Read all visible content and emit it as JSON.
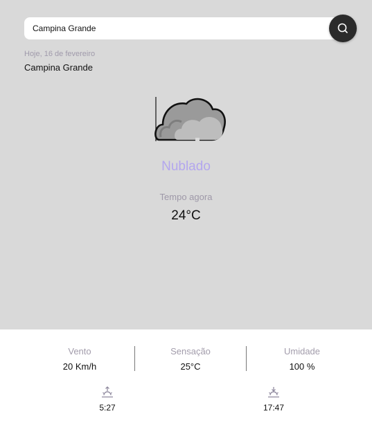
{
  "search": {
    "value": "Campina Grande",
    "icon": "search-icon"
  },
  "location": {
    "date": "Hoje, 16 de fevereiro",
    "city": "Campina Grande"
  },
  "weather": {
    "icon": "cloud-icon",
    "condition": "Nublado",
    "now_label": "Tempo agora",
    "temperature": "24°C"
  },
  "stats": [
    {
      "label": "Vento",
      "value": "20 Km/h"
    },
    {
      "label": "Sensação",
      "value": "25°C"
    },
    {
      "label": "Umidade",
      "value": "100 %"
    }
  ],
  "sun": {
    "sunrise": {
      "icon": "sunrise-icon",
      "time": "5:27"
    },
    "sunset": {
      "icon": "sunset-icon",
      "time": "17:47"
    }
  },
  "colors": {
    "background": "#d9d9d9",
    "accent": "#b3a6ee",
    "search_button": "#2b2b2b"
  }
}
